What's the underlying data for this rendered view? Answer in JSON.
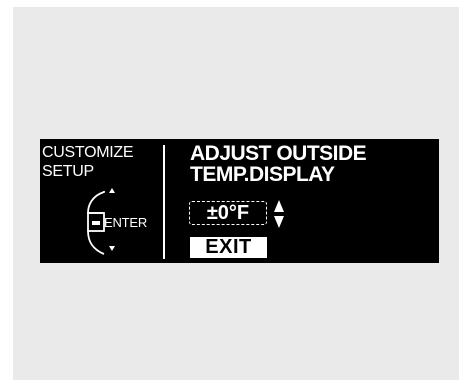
{
  "menu": {
    "category_line1": "CUSTOMIZE",
    "category_line2": "SETUP",
    "enter_label": "ENTER"
  },
  "setting": {
    "title_line1": "ADJUST OUTSIDE",
    "title_line2": "TEMP.DISPLAY",
    "value": "±0°F",
    "exit_label": "EXIT"
  },
  "icons": {
    "selector_knob": "selector-knob-icon",
    "knob_up": "triangle-up-icon",
    "knob_down": "triangle-down-icon",
    "value_adjust": "up-down-arrows-icon"
  },
  "colors": {
    "display_background": "#000000",
    "display_text": "#ffffff",
    "page_background": "#eaeaea"
  }
}
